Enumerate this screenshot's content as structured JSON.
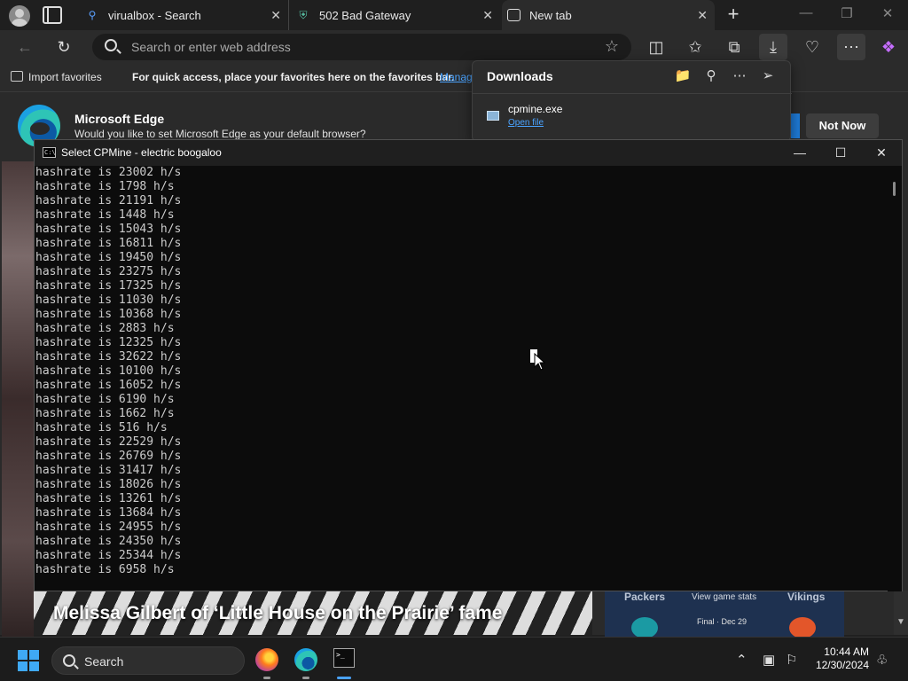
{
  "browser": {
    "tabs": [
      {
        "label": "virualbox - Search",
        "icon": "search-icon"
      },
      {
        "label": "502 Bad Gateway",
        "icon": "vpn-shield-icon"
      },
      {
        "label": "New tab",
        "icon": "new-tab-icon"
      }
    ],
    "address_placeholder": "Search or enter web address",
    "favorites_bar": {
      "import_label": "Import favorites",
      "message": "For quick access, place your favorites here on the favorites bar.",
      "manage_link": "Manag"
    }
  },
  "downloads_panel": {
    "title": "Downloads",
    "file_name": "cpmine.exe",
    "open_file_label": "Open file"
  },
  "default_banner": {
    "title": "Microsoft Edge",
    "subtitle": "Would you like to set Microsoft Edge as your default browser?",
    "not_now_label": "Not Now"
  },
  "news": {
    "headline": "Melissa Gilbert of ‘Little House on the Prairie’ fame",
    "sports": {
      "team_left": "Packers",
      "stats_link": "View game stats",
      "team_right": "Vikings",
      "final_label": "Final · Dec 29"
    }
  },
  "console": {
    "title": "Select CPMine - electric boogaloo",
    "lines": [
      "hashrate is 23002 h/s",
      "hashrate is 1798 h/s",
      "hashrate is 21191 h/s",
      "hashrate is 1448 h/s",
      "hashrate is 15043 h/s",
      "hashrate is 16811 h/s",
      "hashrate is 19450 h/s",
      "hashrate is 23275 h/s",
      "hashrate is 17325 h/s",
      "hashrate is 11030 h/s",
      "hashrate is 10368 h/s",
      "hashrate is 2883 h/s",
      "hashrate is 12325 h/s",
      "hashrate is 32622 h/s",
      "hashrate is 10100 h/s",
      "hashrate is 16052 h/s",
      "hashrate is 6190 h/s",
      "hashrate is 1662 h/s",
      "hashrate is 516 h/s",
      "hashrate is 22529 h/s",
      "hashrate is 26769 h/s",
      "hashrate is 31417 h/s",
      "hashrate is 18026 h/s",
      "hashrate is 13261 h/s",
      "hashrate is 13684 h/s",
      "hashrate is 24955 h/s",
      "hashrate is 24350 h/s",
      "hashrate is 25344 h/s",
      "hashrate is 6958 h/s"
    ]
  },
  "taskbar": {
    "search_label": "Search",
    "time": "10:44 AM",
    "date": "12/30/2024"
  },
  "colors": {
    "accent": "#4aa3ff",
    "console_bg": "#0c0c0c",
    "console_text": "#cccccc"
  }
}
